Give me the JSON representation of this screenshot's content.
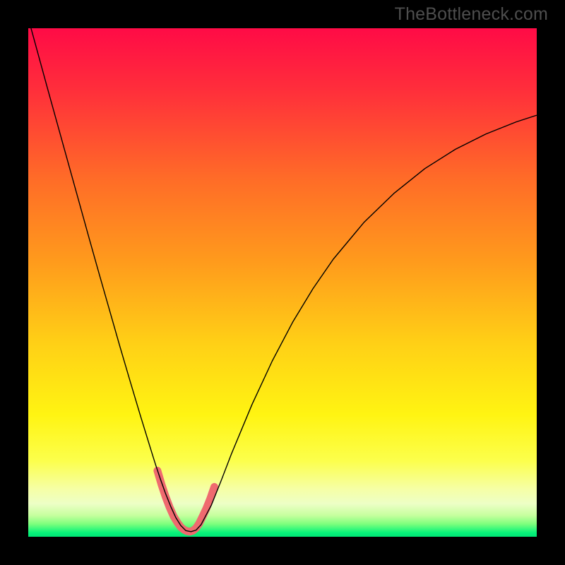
{
  "watermark": "TheBottleneck.com",
  "chart_data": {
    "type": "line",
    "title": "",
    "xlabel": "",
    "ylabel": "",
    "xlim": [
      0,
      100
    ],
    "ylim": [
      0,
      100
    ],
    "grid": false,
    "legend": false,
    "annotations": [],
    "background_gradient": {
      "stops": [
        {
          "pos": 0.0,
          "color": "#ff0b46"
        },
        {
          "pos": 0.12,
          "color": "#ff2e3b"
        },
        {
          "pos": 0.3,
          "color": "#ff6d27"
        },
        {
          "pos": 0.46,
          "color": "#ff9b1c"
        },
        {
          "pos": 0.62,
          "color": "#ffd016"
        },
        {
          "pos": 0.76,
          "color": "#fff412"
        },
        {
          "pos": 0.85,
          "color": "#fcff4b"
        },
        {
          "pos": 0.905,
          "color": "#f6ffa4"
        },
        {
          "pos": 0.935,
          "color": "#edffc6"
        },
        {
          "pos": 0.958,
          "color": "#c6ff9e"
        },
        {
          "pos": 0.975,
          "color": "#7dff7d"
        },
        {
          "pos": 0.992,
          "color": "#07f37a"
        },
        {
          "pos": 1.0,
          "color": "#00e676"
        }
      ]
    },
    "series": [
      {
        "name": "bottleneck-curve",
        "color": "#000000",
        "width": 1.4,
        "x": [
          0.0,
          2.0,
          4.0,
          6.0,
          8.0,
          10.0,
          12.0,
          14.0,
          16.0,
          18.0,
          20.0,
          22.0,
          24.0,
          25.0,
          26.0,
          27.0,
          28.0,
          29.0,
          30.0,
          31.0,
          32.0,
          33.0,
          34.0,
          36.0,
          38.0,
          40.0,
          44.0,
          48.0,
          52.0,
          56.0,
          60.0,
          66.0,
          72.0,
          78.0,
          84.0,
          90.0,
          96.0,
          100.0
        ],
        "y": [
          102.0,
          94.7,
          87.4,
          80.2,
          73.0,
          65.8,
          58.6,
          51.5,
          44.5,
          37.5,
          30.7,
          24.0,
          17.5,
          14.3,
          11.3,
          8.5,
          6.0,
          3.8,
          2.2,
          1.2,
          1.0,
          1.3,
          2.4,
          6.2,
          11.2,
          16.4,
          26.0,
          34.6,
          42.2,
          48.8,
          54.6,
          61.8,
          67.6,
          72.4,
          76.2,
          79.2,
          81.6,
          82.9
        ]
      },
      {
        "name": "optimal-band-marker",
        "color": "#ef6a6f",
        "width": 11,
        "linecap": "round",
        "x": [
          25.4,
          26.2,
          27.0,
          27.8,
          28.6,
          29.4,
          30.0,
          30.6,
          31.2,
          31.8,
          32.4,
          33.0,
          33.6,
          34.2,
          35.0,
          35.8,
          36.6
        ],
        "y": [
          13.0,
          10.3,
          7.9,
          5.8,
          4.0,
          2.7,
          1.9,
          1.4,
          1.1,
          1.0,
          1.2,
          1.7,
          2.6,
          3.8,
          5.5,
          7.5,
          9.8
        ]
      }
    ]
  }
}
